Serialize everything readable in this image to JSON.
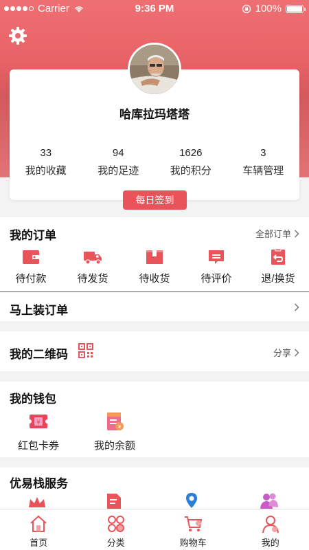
{
  "status_bar": {
    "carrier": "Carrier",
    "time": "9:36 PM",
    "battery": "100%"
  },
  "profile": {
    "username": "哈库拉玛塔塔",
    "stats": [
      {
        "value": "33",
        "label": "我的收藏"
      },
      {
        "value": "94",
        "label": "我的足迹"
      },
      {
        "value": "1626",
        "label": "我的积分"
      },
      {
        "value": "3",
        "label": "车辆管理"
      }
    ],
    "checkin_label": "每日签到"
  },
  "orders": {
    "title": "我的订单",
    "all_label": "全部订单",
    "items": [
      {
        "label": "待付款",
        "icon": "wallet-icon"
      },
      {
        "label": "待发货",
        "icon": "truck-icon"
      },
      {
        "label": "待收货",
        "icon": "box-icon"
      },
      {
        "label": "待评价",
        "icon": "comment-icon"
      },
      {
        "label": "退/换货",
        "icon": "return-icon"
      }
    ]
  },
  "install_order": {
    "title": "马上装订单"
  },
  "qrcode": {
    "title": "我的二维码",
    "share_label": "分享"
  },
  "wallet": {
    "title": "我的钱包",
    "items": [
      {
        "label": "红包卡券",
        "icon": "coupon-icon"
      },
      {
        "label": "我的余额",
        "icon": "balance-icon"
      }
    ]
  },
  "services": {
    "title": "优易栈服务"
  },
  "tabbar": [
    {
      "label": "首页",
      "icon": "home-icon"
    },
    {
      "label": "分类",
      "icon": "category-icon"
    },
    {
      "label": "购物车",
      "icon": "cart-icon"
    },
    {
      "label": "我的",
      "icon": "user-icon"
    }
  ],
  "colors": {
    "accent": "#e8545a",
    "header": "#e86266"
  }
}
